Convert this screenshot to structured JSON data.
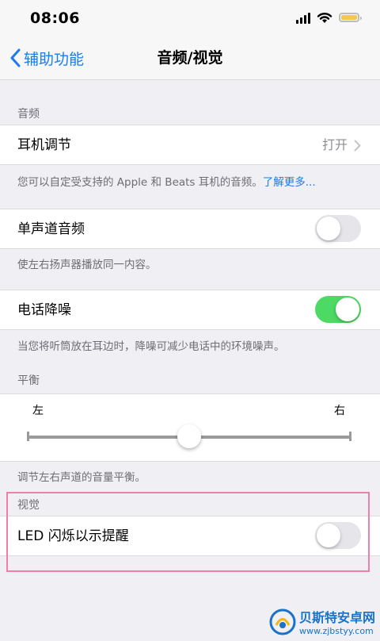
{
  "status_bar": {
    "time": "08:06"
  },
  "nav": {
    "back_label": "辅助功能",
    "title": "音频/视觉"
  },
  "audio": {
    "header": "音频",
    "headphone_row": {
      "label": "耳机调节",
      "value": "打开"
    },
    "headphone_note": "您可以自定受支持的 Apple 和 Beats 耳机的音频。",
    "learn_more": "了解更多...",
    "mono_row": {
      "label": "单声道音频",
      "on": false
    },
    "mono_note": "使左右扬声器播放同一内容。",
    "noise_row": {
      "label": "电话降噪",
      "on": true
    },
    "noise_note": "当您将听筒放在耳边时，降噪可减少电话中的环境噪声。"
  },
  "balance": {
    "header": "平衡",
    "left_label": "左",
    "right_label": "右",
    "value": 0.5,
    "note": "调节左右声道的音量平衡。"
  },
  "visual": {
    "header": "视觉",
    "led_row": {
      "label": "LED 闪烁以示提醒",
      "on": false
    }
  },
  "watermark": {
    "title": "贝斯特安卓网",
    "url": "www.zjbstyy.com"
  },
  "colors": {
    "accent": "#1a7cf0",
    "switch_on": "#4cd964",
    "highlight": "#ef7fa4"
  }
}
